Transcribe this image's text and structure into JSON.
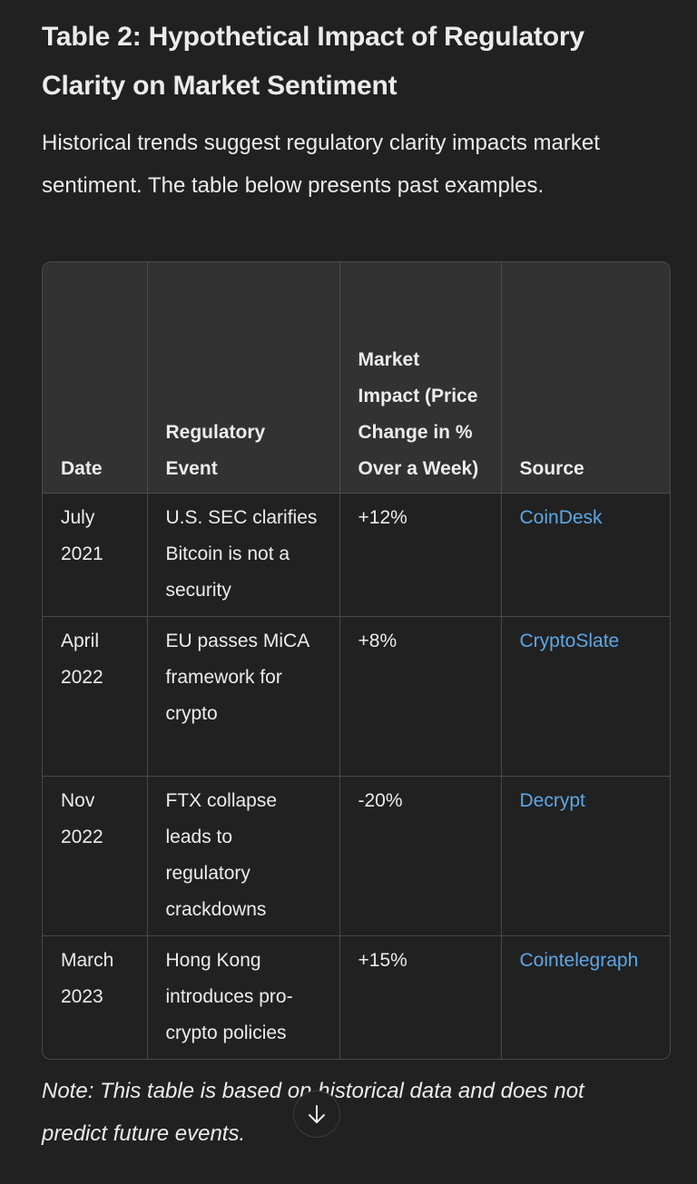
{
  "heading": {
    "title": "Table 2: Hypothetical Impact of Regulatory Clarity on Market Sentiment"
  },
  "intro": "Historical trends suggest regulatory clarity impacts market sentiment. The table below presents past examples.",
  "table": {
    "headers": {
      "date": "Date",
      "event": "Regulatory Event",
      "impact": "Market Impact (Price Change in % Over a Week)",
      "source": "Source"
    },
    "rows": [
      {
        "date": "July 2021",
        "event": "U.S. SEC clarifies Bitcoin is not a security",
        "impact": "+12%",
        "source": "CoinDesk"
      },
      {
        "date": "April 2022",
        "event": "EU passes MiCA framework for crypto",
        "impact": "+8%",
        "source": "CryptoSlate"
      },
      {
        "date": "Nov 2022",
        "event": "FTX collapse leads to regulatory crackdowns",
        "impact": "-20%",
        "source": "Decrypt"
      },
      {
        "date": "March 2023",
        "event": "Hong Kong introduces pro-crypto policies",
        "impact": "+15%",
        "source": "Cointelegraph"
      }
    ]
  },
  "note": "Note: This table is based on historical data and does not predict future events.",
  "scroll_button": {
    "icon": "arrow-down-icon"
  },
  "colors": {
    "background": "#212121",
    "header_bg": "#323232",
    "link": "#5ea7e6",
    "text": "#ececec",
    "border": "#4a4a4a"
  }
}
